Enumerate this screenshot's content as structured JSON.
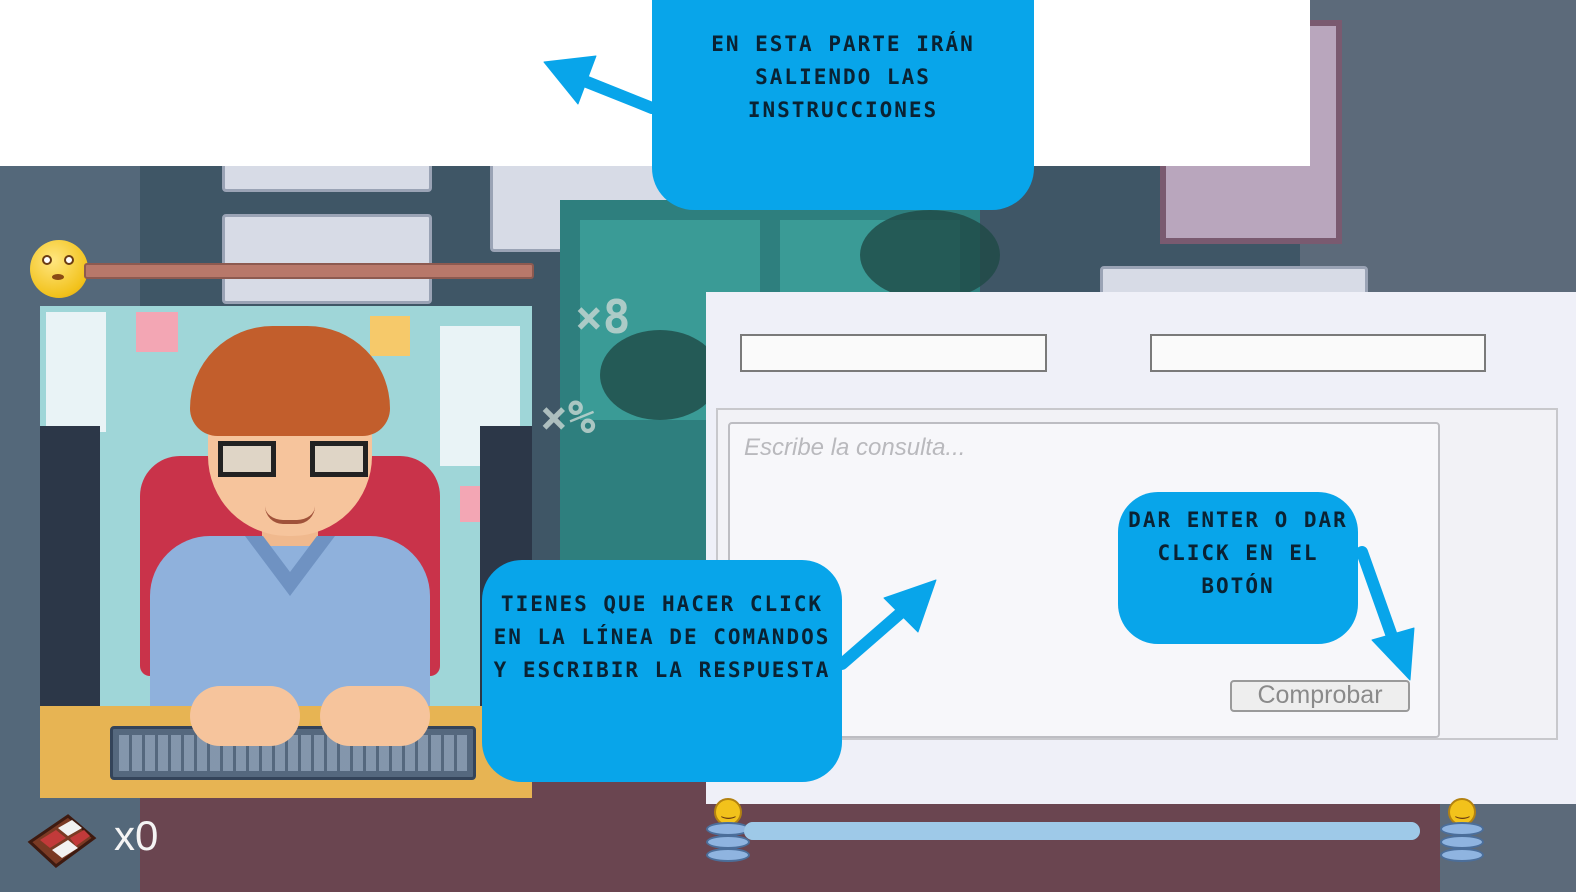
{
  "tutorial": {
    "instructions_bubble": "En esta parte irán saliendo las instrucciones",
    "command_line_bubble": "Tienes que hacer click en la línea de comandos y escribir la respuesta",
    "submit_bubble": "Dar enter o dar click en el botón"
  },
  "console": {
    "query_placeholder": "Escribe la consulta...",
    "check_button_label": "Comprobar"
  },
  "inventory": {
    "item_icon": "chocolate-bar-icon",
    "item_count": "x0"
  },
  "status": {
    "mood_icon": "worried-face-icon",
    "progress_icon": "smiling-database-icon",
    "goal_icon": "smiling-database-icon",
    "progress_fraction": 1.0
  },
  "colors": {
    "bubble": "#08a5ea",
    "panel": "#eff0f8",
    "mood_bar": "#b8786a",
    "progress_bar": "#9ec9e8"
  }
}
